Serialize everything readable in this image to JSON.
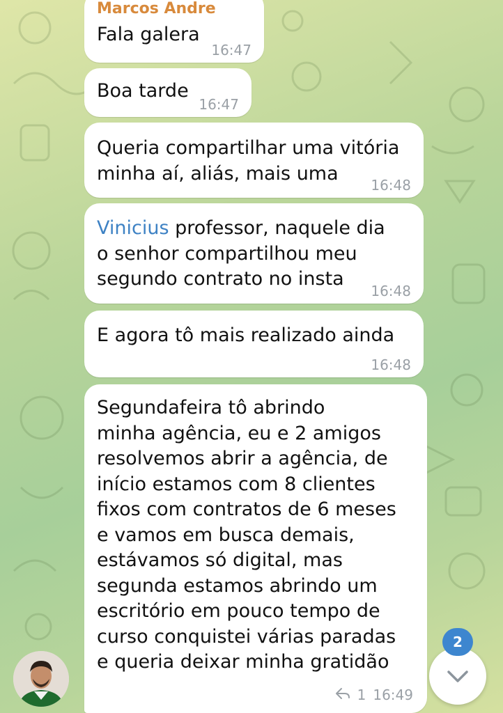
{
  "chat": {
    "background_colors": [
      "#dfe6a8",
      "#a7cf9a",
      "#d5e0a0"
    ],
    "bubble_color": "#ffffff",
    "messages": [
      {
        "sender": "Marcos Andre",
        "text": "Fala galera",
        "time": "16:47"
      },
      {
        "text": "Boa tarde",
        "time": "16:47"
      },
      {
        "text": "Queria compartilhar uma vitória\nminha aí, aliás, mais uma",
        "time": "16:48"
      },
      {
        "mention": "Vinicius",
        "text": " professor, naquele dia\no senhor compartilhou meu\nsegundo contrato no insta",
        "time": "16:48"
      },
      {
        "text": "E agora tô mais realizado ainda",
        "time": "16:48"
      },
      {
        "text": "Segundafeira tô abrindo\nminha agência, eu e 2 amigos\nresolvemos abrir a agência, de\ninício estamos com 8 clientes\nfixos com contratos de 6 meses\ne vamos em busca demais,\nestávamos só digital, mas\nsegunda estamos abrindo um\nescritório em pouco tempo de\ncurso conquistei várias paradas\ne queria deixar minha gratidão",
        "time": "16:49",
        "reply_count": "1",
        "reply_icon": "reply-arrow-icon"
      }
    ]
  },
  "scroll_button": {
    "badge_count": "2",
    "icon": "chevron-down-icon",
    "badge_color": "#3d86cf"
  },
  "avatar": {
    "icon": "user-avatar"
  },
  "colors": {
    "sender_name": "#d88a3c",
    "mention": "#3e82c4",
    "timestamp": "#9aa0a6"
  }
}
